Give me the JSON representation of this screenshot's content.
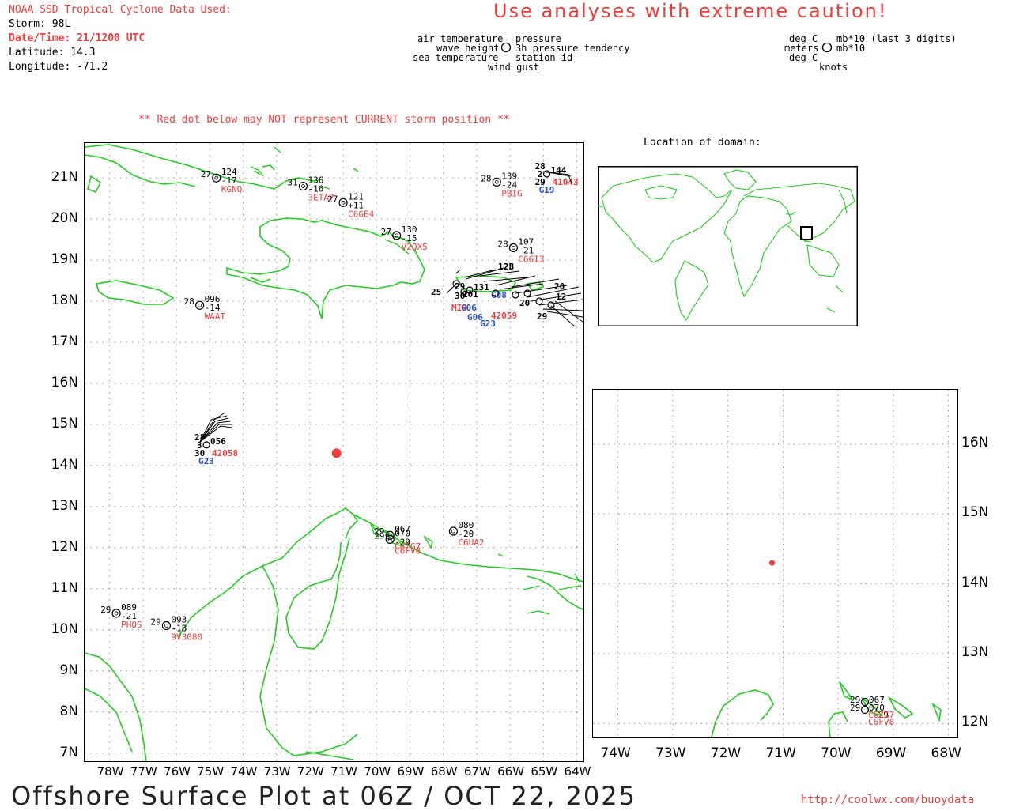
{
  "header": {
    "source_title": "NOAA SSD Tropical Cyclone Data Used:",
    "storm": "Storm: 98L",
    "datetime": "Date/Time: 21/1200 UTC",
    "latitude": "Latitude: 14.3",
    "longitude": "Longitude: -71.2",
    "caution": "Use analyses with extreme caution!"
  },
  "legend": {
    "left": {
      "air_temperature": "air temperature",
      "wave_height": "wave height",
      "sea_temperature": "sea temperature",
      "pressure": "pressure",
      "pressure_tendency": "3h pressure tendency",
      "station_id": "station id",
      "wind_gust": "wind gust"
    },
    "units": {
      "deg_c_1": "deg C",
      "meters": "meters",
      "deg_c_2": "deg C",
      "mb_last3": "mb*10 (last 3 digits)",
      "mb10": "mb*10",
      "knots": "knots"
    }
  },
  "warning": "** Red dot below may NOT represent CURRENT storm position **",
  "main_map": {
    "lat_labels": [
      "21N",
      "20N",
      "19N",
      "18N",
      "17N",
      "16N",
      "15N",
      "14N",
      "13N",
      "12N",
      "11N",
      "10N",
      "9N",
      "8N",
      "7N"
    ],
    "lon_labels": [
      "78W",
      "77W",
      "76W",
      "75W",
      "74W",
      "73W",
      "72W",
      "71W",
      "70W",
      "69W",
      "68W",
      "67W",
      "66W",
      "65W",
      "64W"
    ],
    "storm_position": {
      "lat": 14.3,
      "lon": -71.2
    },
    "colors": {
      "coast": "#22cc22",
      "storm": "#f23c3c",
      "station_id": "#f23c3c",
      "buoy_id": "#2a4fd6"
    }
  },
  "stations": [
    {
      "id": "KGNQ",
      "lat": 21.0,
      "lon": -74.8,
      "air": "27",
      "pres": "124",
      "tend": "-17"
    },
    {
      "id": "3ETA7",
      "lat": 20.8,
      "lon": -72.2,
      "air": "31",
      "pres": "136",
      "tend": "-16"
    },
    {
      "id": "C6GE4",
      "lat": 20.4,
      "lon": -71.0,
      "air": "27",
      "pres": "121",
      "tend": "+11"
    },
    {
      "id": "V2QX5",
      "lat": 19.6,
      "lon": -69.4,
      "air": "27",
      "pres": "130",
      "tend": "-15"
    },
    {
      "id": "PBIG",
      "lat": 20.9,
      "lon": -66.4,
      "air": "28",
      "pres": "139",
      "tend": "-24"
    },
    {
      "id": "C6GI3",
      "lat": 19.3,
      "lon": -65.9,
      "air": "28",
      "pres": "107",
      "tend": "-21"
    },
    {
      "id": "WAAT",
      "lat": 17.9,
      "lon": -75.3,
      "air": "28",
      "pres": "096",
      "tend": "-14"
    },
    {
      "id": "C6ZG7",
      "lat": 12.3,
      "lon": -69.6,
      "air": "29",
      "pres": "067",
      "tend": ""
    },
    {
      "id": "C6FV8",
      "lat": 12.2,
      "lon": -69.6,
      "air": "29",
      "pres": "070",
      "tend": "-29"
    },
    {
      "id": "C6UA2",
      "lat": 12.4,
      "lon": -67.7,
      "air": "",
      "pres": "080",
      "tend": "-20"
    },
    {
      "id": "PHOS",
      "lat": 10.4,
      "lon": -77.8,
      "air": "29",
      "pres": "089",
      "tend": "-21"
    },
    {
      "id": "9V3080",
      "lat": 10.1,
      "lon": -76.3,
      "air": "29",
      "pres": "093",
      "tend": "-18"
    }
  ],
  "buoys": [
    {
      "id": "42058",
      "id2": "G23",
      "lat": 14.5,
      "lon": -75.1,
      "air": "28",
      "wave": "3",
      "sst": "30",
      "pres": "056"
    },
    {
      "id": "41043",
      "id2": "G19",
      "lat": 21.1,
      "lon": -64.9,
      "air": "28",
      "wave": "2",
      "sst": "29",
      "pres": "144"
    }
  ],
  "cluster_labels": {
    "nums": [
      "25",
      "30",
      "29",
      "131",
      "101",
      "12",
      "20",
      "125",
      "28",
      "20",
      "29"
    ],
    "ids": [
      "MID",
      "G06",
      "G23",
      "G08",
      "G06",
      "42059"
    ]
  },
  "inset_world": {
    "title": "Location of domain:",
    "domain_box": {
      "lat_min": 7,
      "lat_max": 22,
      "lon_min": -79,
      "lon_max": -64
    }
  },
  "zoom_map": {
    "lat_labels": [
      "16N",
      "15N",
      "14N",
      "13N",
      "12N"
    ],
    "lon_labels": [
      "74W",
      "73W",
      "72W",
      "71W",
      "70W",
      "69W",
      "68W"
    ],
    "storm_position": {
      "lat": 14.3,
      "lon": -71.2
    },
    "stations": [
      {
        "id": "C6ZG7",
        "air": "29",
        "pres": "067"
      },
      {
        "id": "C6FV8",
        "air": "29",
        "pres": "070",
        "tend": "-29"
      }
    ]
  },
  "footer": {
    "title": "Offshore Surface Plot at 06Z / OCT 22, 2025",
    "url": "http://coolwx.com/buoydata"
  }
}
